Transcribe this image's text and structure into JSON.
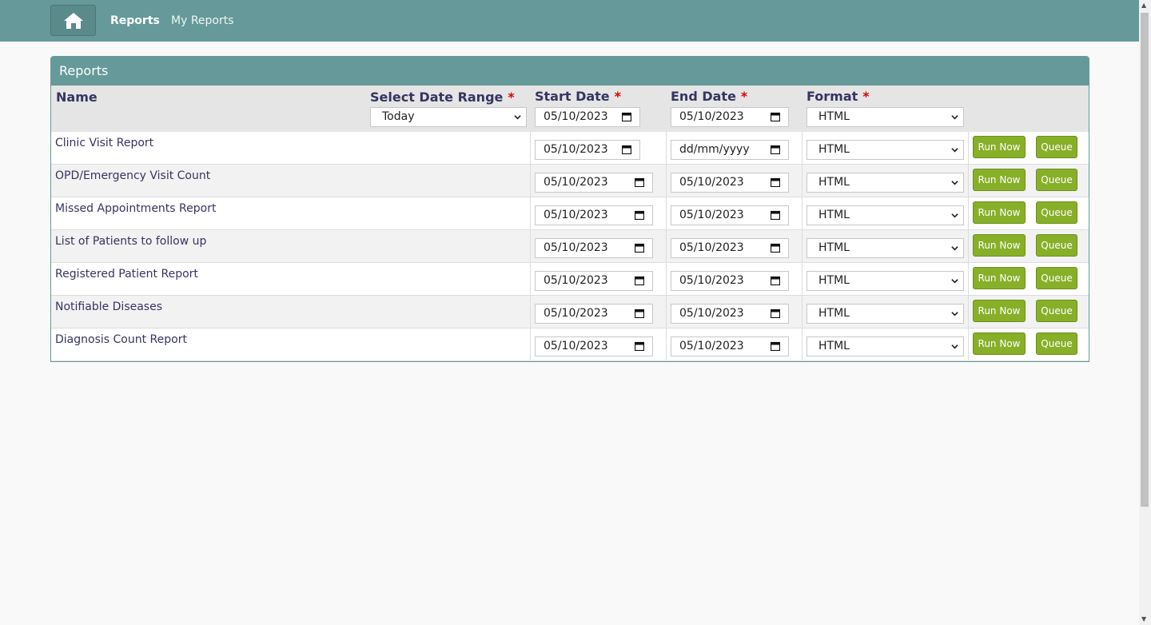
{
  "nav": {
    "home_icon": "home-icon",
    "reports_label": "Reports",
    "my_reports_label": "My Reports"
  },
  "panel": {
    "title": "Reports"
  },
  "columns": {
    "name": "Name",
    "date_range": "Select Date Range",
    "start_date": "Start Date",
    "end_date": "End Date",
    "format": "Format",
    "required_mark": "*"
  },
  "header_filters": {
    "date_range_value": "Today",
    "start_date_value": "05/10/2023",
    "end_date_value": "05/10/2023",
    "format_value": "HTML"
  },
  "rows": [
    {
      "name": "Clinic Visit Report",
      "start": "05/10/2023",
      "end": "dd/mm/yyyy",
      "format": "HTML",
      "run": "Run Now",
      "queue": "Queue"
    },
    {
      "name": "OPD/Emergency Visit Count",
      "start": "05/10/2023",
      "end": "05/10/2023",
      "format": "HTML",
      "run": "Run Now",
      "queue": "Queue"
    },
    {
      "name": "Missed Appointments Report",
      "start": "05/10/2023",
      "end": "05/10/2023",
      "format": "HTML",
      "run": "Run Now",
      "queue": "Queue"
    },
    {
      "name": "List of Patients to follow up",
      "start": "05/10/2023",
      "end": "05/10/2023",
      "format": "HTML",
      "run": "Run Now",
      "queue": "Queue"
    },
    {
      "name": "Registered Patient Report",
      "start": "05/10/2023",
      "end": "05/10/2023",
      "format": "HTML",
      "run": "Run Now",
      "queue": "Queue"
    },
    {
      "name": "Notifiable Diseases",
      "start": "05/10/2023",
      "end": "05/10/2023",
      "format": "HTML",
      "run": "Run Now",
      "queue": "Queue"
    },
    {
      "name": "Diagnosis Count Report",
      "start": "05/10/2023",
      "end": "05/10/2023",
      "format": "HTML",
      "run": "Run Now",
      "queue": "Queue"
    }
  ],
  "colors": {
    "header_bar": "#669999",
    "button_green": "#88af28",
    "text": "#363463",
    "required": "#dd0000"
  }
}
